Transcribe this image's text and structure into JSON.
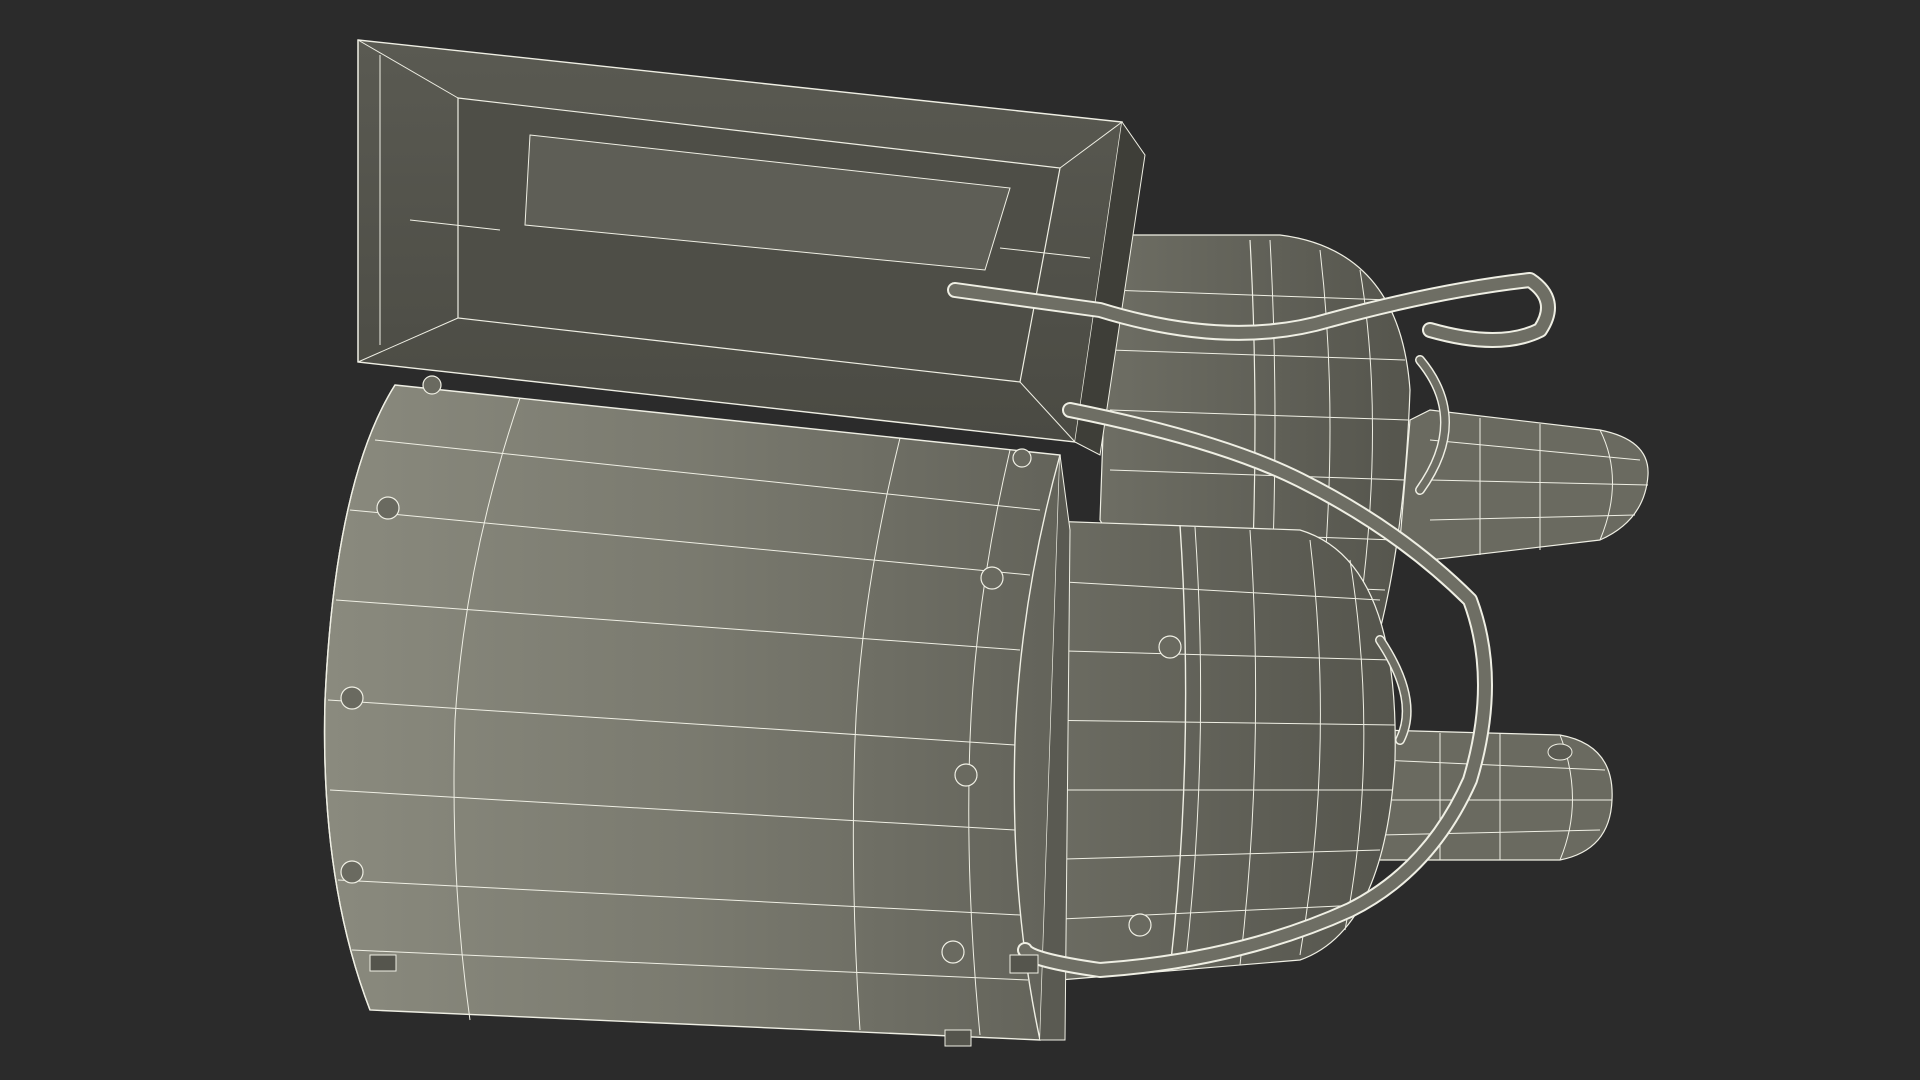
{
  "scene": {
    "background_color": "#2b2b2b",
    "model_fill_color": "#77776c",
    "model_shade_color": "#5c5c53",
    "model_dark_color": "#46463f",
    "wireframe_color": "#efefe4",
    "subject": "wireframe-engine-model"
  }
}
